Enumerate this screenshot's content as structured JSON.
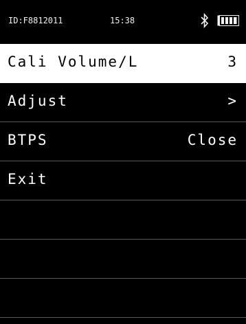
{
  "status": {
    "device_id": "ID:F8812011",
    "time": "15:38",
    "bluetooth_icon": "bluetooth-icon",
    "battery_icon": "battery-full-icon"
  },
  "menu": {
    "items": [
      {
        "label": "Cali Volume/L",
        "value": "3",
        "selected": true
      },
      {
        "label": "Adjust",
        "value": ">",
        "selected": false
      },
      {
        "label": "BTPS",
        "value": "Close",
        "selected": false
      },
      {
        "label": "Exit",
        "value": "",
        "selected": false
      }
    ]
  },
  "colors": {
    "background": "#000000",
    "selected_background": "#ffffff",
    "divider": "#5c5c5c"
  }
}
